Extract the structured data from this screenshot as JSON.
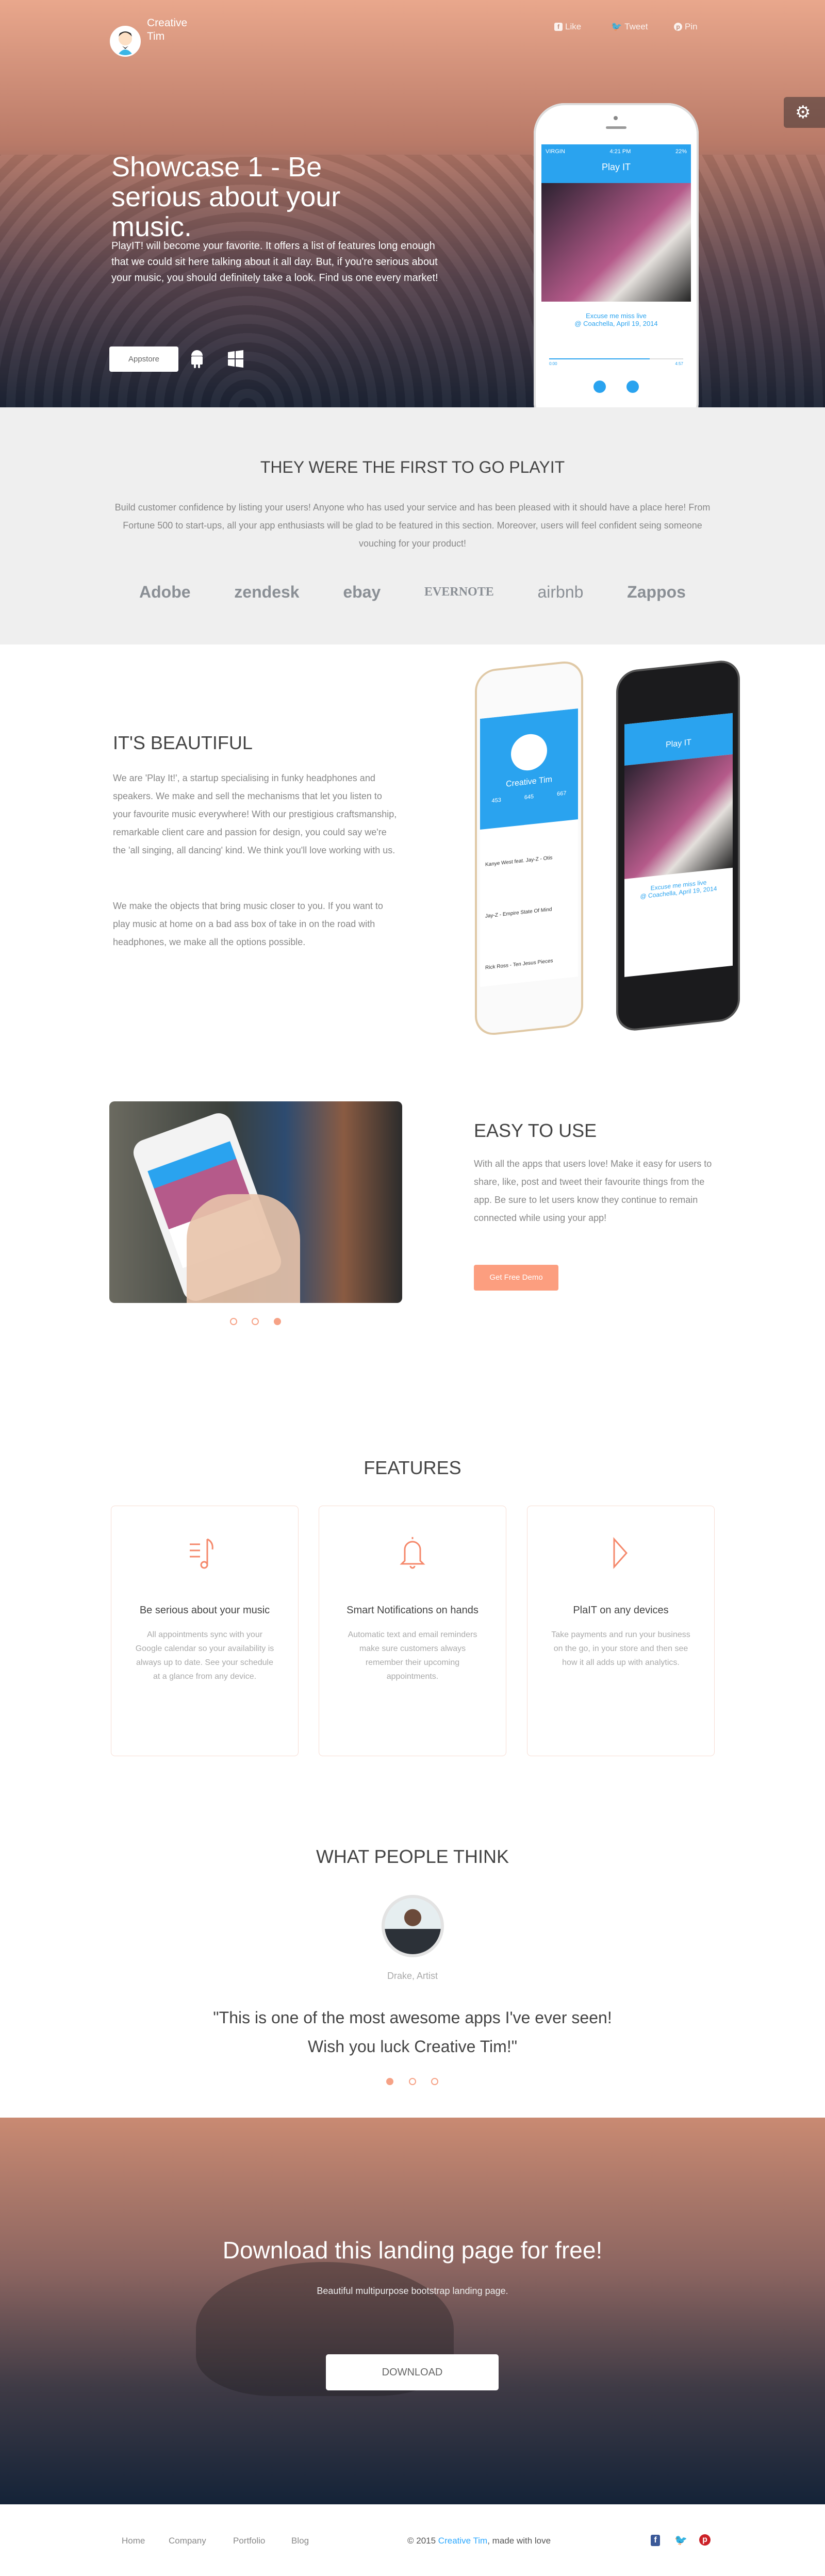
{
  "navbar": {
    "brand": "Creative Tim",
    "social": [
      {
        "icon": "facebook-icon",
        "label": "Like"
      },
      {
        "icon": "twitter-icon",
        "label": "Tweet"
      },
      {
        "icon": "pinterest-icon",
        "label": "Pin"
      }
    ],
    "settings_icon": "gear-icon"
  },
  "hero": {
    "title": "Showcase 1 - Be serious about your music.",
    "text": "PlayIT! will become your favorite. It offers a list of features long enough that we could sit here talking about it all day. But, if you're serious about your music, you should definitely take a look. Find us one every market!",
    "appstore_label": "Appstore",
    "platforms": [
      "android-icon",
      "windows-icon"
    ],
    "phone": {
      "carrier": "VIRGIN",
      "time": "4:21 PM",
      "battery": "22%",
      "app_title": "Play IT",
      "song": "Excuse me miss live",
      "venue": "@ Coachella, April 19, 2014",
      "time_start": "0:00",
      "time_end": "4:57",
      "progress": 0.75
    }
  },
  "clients": {
    "title": "THEY WERE THE FIRST TO GO PLAYIT",
    "text": "Build customer confidence by listing your users! Anyone who has used your service and has been pleased with it should have a place here! From Fortune 500 to start-ups, all your app enthusiasts will be glad to be featured in this section. Moreover, users will feel confident seing someone vouching for your product!",
    "logos": [
      "Adobe",
      "zendesk",
      "ebay",
      "EVERNOTE",
      "airbnb",
      "Zappos"
    ]
  },
  "beautiful": {
    "title": "IT'S BEAUTIFUL",
    "paragraphs": [
      "We are 'Play It!', a startup specialising in funky headphones and speakers. We make and sell the mechanisms that let you listen to your favourite music everywhere! With our prestigious craftsmanship, remarkable client care and passion for design, you could say we're the 'all singing, all dancing' kind. We think you'll love working with us.",
      "We make the objects that bring music closer to you. If you want to play music at home on a bad ass box of take in on the road with headphones, we make all the options possible."
    ],
    "phone": {
      "profile": "Creative Tim",
      "stats": [
        "453",
        "645",
        "667"
      ],
      "feed": [
        "Kanye West feat. Jay-Z - Otis",
        "Jay-Z - Empire State Of Mind",
        "Rick Ross - Ten Jesus Pieces"
      ]
    }
  },
  "easy": {
    "title": "EASY TO USE",
    "text": "With all the apps that users love! Make it easy for users to share, like, post and tweet their favourite things from the app. Be sure to let users know they continue to remain connected while using your app!",
    "button": "Get Free Demo",
    "carousel_active": 3,
    "carousel_count": 3
  },
  "features": {
    "title": "FEATURES",
    "items": [
      {
        "icon": "music-note-icon",
        "title": "Be serious about your music",
        "text": "All appointments sync with your Google calendar so your availability is always up to date. See your schedule at a glance from any device."
      },
      {
        "icon": "bell-icon",
        "title": "Smart Notifications on hands",
        "text": "Automatic text and email reminders make sure customers always remember their upcoming appointments."
      },
      {
        "icon": "play-icon",
        "title": "PlaIT on any devices",
        "text": "Take payments and run your business on the go, in your store and then see how it all adds up with analytics."
      }
    ]
  },
  "testimonials": {
    "title": "WHAT PEOPLE THINK",
    "name": "Drake, Artist",
    "quote": "\"This is one of the most awesome apps I've ever seen! Wish you luck Creative Tim!\"",
    "carousel_active": 1
  },
  "download": {
    "title": "Download this landing page for free!",
    "subtitle": "Beautiful multipurpose bootstrap landing page.",
    "button": "DOWNLOAD"
  },
  "footer": {
    "nav": [
      "Home",
      "Company",
      "Portfolio",
      "Blog"
    ],
    "copyright_prefix": "© 2015 ",
    "copyright_link": "Creative Tim",
    "copyright_suffix": ", made with love",
    "social": [
      "facebook-icon",
      "twitter-icon",
      "pinterest-icon"
    ]
  },
  "colors": {
    "accent": "#fc9e7f",
    "link": "#2ca8ff",
    "app_blue": "#2aa3ef",
    "facebook": "#3b5998",
    "twitter": "#55acee",
    "pinterest": "#cc2127"
  }
}
